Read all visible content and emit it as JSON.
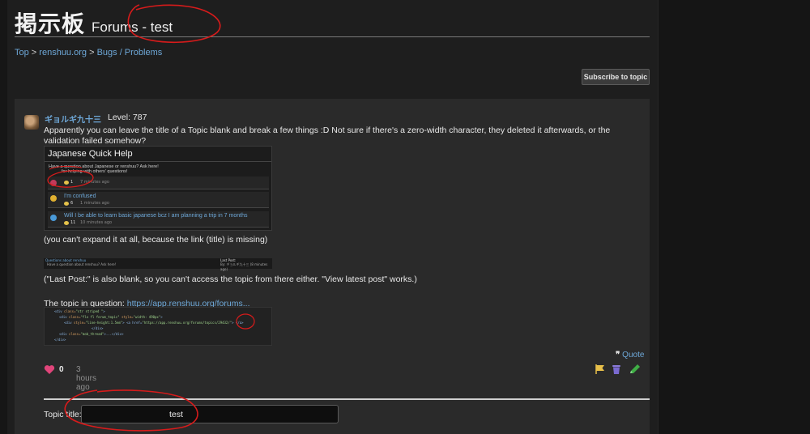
{
  "header": {
    "title_kanji": "掲示板",
    "subtitle": "Forums - test"
  },
  "breadcrumb": [
    {
      "label": "Top",
      "sep": " > "
    },
    {
      "label": "renshuu.org",
      "sep": " > "
    },
    {
      "label": "Bugs / Problems",
      "sep": ""
    }
  ],
  "subscribe_label": "Subscribe to topic",
  "post": {
    "username": "ギョルギ九十三",
    "level": "Level: 787",
    "para1": "Apparently you can leave the title of a Topic blank and break a few things :D Not sure if there's a zero-width character, they deleted it afterwards, or the validation failed somehow?",
    "para2": "(you can't expand it at all, because the link (title) is missing)",
    "para3": "(\"Last Post:\" is also blank, so you can't access the topic from there either. \"View latest post\" works.)",
    "para4_prefix": "The topic in question: ",
    "para4_link": "https://app.renshuu.org/forums...",
    "likes": "0",
    "time_ago": "3 hours ago",
    "quote_label": "Quote",
    "quote_mark": "❞"
  },
  "shot1": {
    "title": "Japanese Quick Help",
    "desc1": "Have a question about Japanese or renshuu? Ask here!",
    "desc2": "for helping with others' questions!",
    "rows": [
      {
        "label": "",
        "count": "1",
        "time": "7 minutes ago"
      },
      {
        "label": "I'm confused",
        "count": "6",
        "time": "1 minutes ago"
      },
      {
        "label": "Will I be able to learn basic japanese bcz I am planning a trip in 7 months",
        "count": "11",
        "time": "10 minutes ago"
      }
    ]
  },
  "shot2": {
    "q1": "Questions about renshuu",
    "q2": "Have a question about renshuu? Ask here!",
    "lp1": "Last Post:",
    "lp2": "By: ギョルギ九十三 (8 minutes ago)"
  },
  "shot3": {
    "l1a": "<div",
    "l1b": " class=",
    "l1c": "\"str striped \"",
    "l1d": ">",
    "l2a": "<div",
    "l2b": " class=",
    "l2c": "\"flx fl  forum_topic\"",
    "l2d": " style=",
    "l2e": "\"width: 490px\"",
    "l2f": ">",
    "l3a": "<div",
    "l3b": " style=",
    "l3c": "\"line-height:1.5em\"",
    "l3d": "> <a href=",
    "l3e": "\"https://app.renshuu.org/forums/topics/29432/\"",
    "l3f": "> </a>",
    "l4a": "</div>",
    "l5a": "<div",
    "l5b": " class=",
    "l5c": "\"mob_thread\"",
    "l5d": ">...</div>",
    "l6a": "</div>"
  },
  "topic_title_label": "Topic title:",
  "topic_title_value": "test",
  "colors": {
    "link": "#6ea8d8",
    "annotation_red": "#d81b1b"
  }
}
